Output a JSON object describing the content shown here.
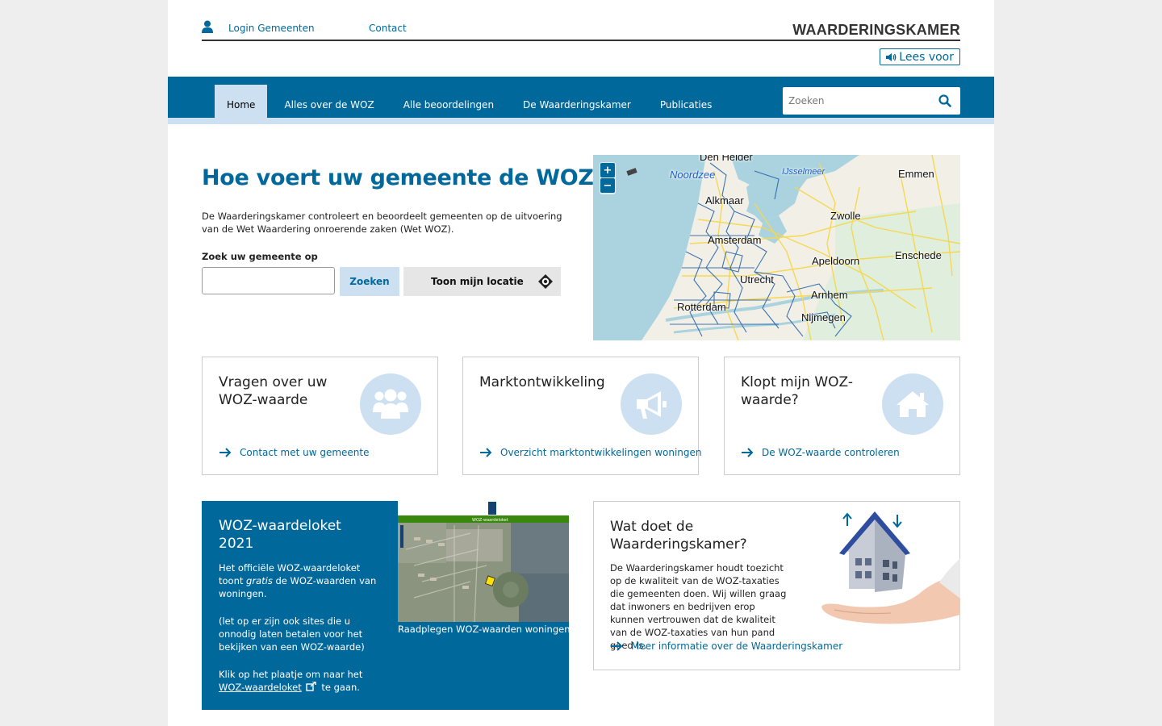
{
  "header": {
    "login_label": "Login Gemeenten",
    "contact_label": "Contact",
    "site_title": "WAARDERINGSKAMER",
    "read_aloud_label": "Lees voor"
  },
  "nav": {
    "items": [
      {
        "label": "Home",
        "active": true
      },
      {
        "label": "Alles over de WOZ",
        "active": false
      },
      {
        "label": "Alle beoordelingen",
        "active": false
      },
      {
        "label": "De Waarderingskamer",
        "active": false
      },
      {
        "label": "Publicaties",
        "active": false
      }
    ],
    "search_placeholder": "Zoeken"
  },
  "intro": {
    "title": "Hoe voert uw gemeente de WOZ uit?",
    "text": "De Waarderingskamer controleert en beoordeelt gemeenten op de uitvoering van de Wet Waardering onroerende zaken (Wet WOZ).",
    "search_label": "Zoek uw gemeente op",
    "search_value": "",
    "search_button": "Zoeken",
    "location_button": "Toon mijn locatie"
  },
  "map": {
    "zoom_in": "+",
    "zoom_out": "−",
    "labels": {
      "den_helder": "Den Helder",
      "noordzee": "Noordzee",
      "ijsselmeer": "IJsselmeer",
      "emmen": "Emmen",
      "alkmaar": "Alkmaar",
      "zwolle": "Zwolle",
      "amsterdam": "Amsterdam",
      "enschede": "Enschede",
      "apeldoorn": "Apeldoorn",
      "utrecht": "Utrecht",
      "arnhem": "Arnhem",
      "rotterdam": "Rotterdam",
      "nijmegen": "Nijmegen"
    }
  },
  "cards": [
    {
      "title": "Vragen over uw WOZ-waarde",
      "link": "Contact met uw gemeente",
      "icon": "users-icon"
    },
    {
      "title": "Marktontwikkeling",
      "link": "Overzicht marktontwikkelingen woningen",
      "icon": "megaphone-icon"
    },
    {
      "title": "Klopt mijn WOZ-waarde?",
      "link": "De WOZ-waarde controleren",
      "icon": "home-icon"
    }
  ],
  "loket": {
    "title": "WOZ-waardeloket 2021",
    "p1_before": "Het officiële WOZ-waardeloket toont ",
    "p1_em": "gratis",
    "p1_after": " de WOZ-waarden van woningen.",
    "p2": "(let op er zijn ook sites die u onnodig laten betalen voor het bekijken van een WOZ-waarde)",
    "p3_before": "Klik op het plaatje om naar het ",
    "p3_link": "WOZ-waardeloket",
    "p3_after": " te gaan.",
    "caption": "Raadplegen WOZ-waarden woningen",
    "screenshot_title": "WOZ-waardeloket"
  },
  "about": {
    "title": "Wat doet de Waarderingskamer?",
    "text": "De Waarderingskamer houdt toezicht op de kwaliteit van de WOZ-taxaties die gemeenten doen. Wij willen graag dat inwoners en bedrijven erop kunnen vertrouwen dat de kwaliteit van de WOZ-taxaties van hun pand goed is.",
    "link": "Meer informatie over de Waarderingskamer"
  },
  "colors": {
    "primary": "#01689b",
    "light_blue": "#cce0f1"
  }
}
